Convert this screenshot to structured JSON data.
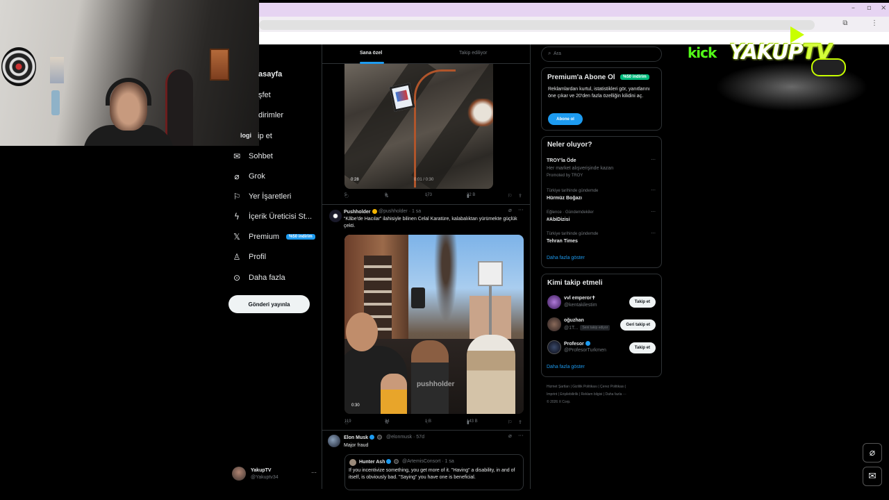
{
  "colors": {
    "accent": "#1d9bf0",
    "background": "#000000",
    "border": "#2f3336",
    "muted": "#71767b",
    "kick_green": "#53fc18"
  },
  "overlay": {
    "kick_label": "kick",
    "brand_main": "YAKUP",
    "brand_tv": "TV"
  },
  "nav": {
    "partial_items": [
      {
        "label": "asayfa"
      },
      {
        "label": "şfet"
      },
      {
        "label": "dirimler"
      },
      {
        "label": "ip et"
      }
    ],
    "overlap_text": "logi",
    "items": [
      {
        "label": "Sohbet",
        "icon": "mail-icon"
      },
      {
        "label": "Grok",
        "icon": "grok-icon"
      },
      {
        "label": "Yer İşaretleri",
        "icon": "bookmark-icon"
      },
      {
        "label": "İçerik Üreticisi St...",
        "icon": "lightning-icon"
      },
      {
        "label": "Premium",
        "icon": "x-logo-icon",
        "badge": "%50 indirim"
      },
      {
        "label": "Profil",
        "icon": "person-icon"
      },
      {
        "label": "Daha fazla",
        "icon": "more-circle-icon"
      }
    ],
    "post_button": "Gönderi yayınla",
    "account": {
      "name": "YakupTV",
      "handle": "@Yakuptv34",
      "more": "···"
    }
  },
  "feed": {
    "tabs": [
      {
        "label": "Sana özel"
      },
      {
        "label": "Takip ediliyor"
      }
    ],
    "post1": {
      "video_elapsed": "0:28",
      "video_progress": "0:01 / 0:30",
      "actions": {
        "replies": "5",
        "reposts": "8",
        "likes": "173",
        "views": "22 B"
      }
    },
    "post2": {
      "name": "Pushholder",
      "handle": "@pushholder · 1 sa",
      "text": "“Kâbe'de Hacılar” ilahisiyle bilinen Celal Karatüre, kalabalıktan yürümekte güçlük çekti.",
      "watermark": "pushholder",
      "video_time": "0:30",
      "actions": {
        "replies": "119",
        "reposts": "34",
        "likes": "1 B",
        "views": "143 B"
      }
    },
    "post3": {
      "name": "Elon Musk",
      "handle": "@elonmusk · 57d",
      "text": "Major fraud",
      "quote": {
        "name": "Hunter Ash",
        "handle": "@ArtemisConsort · 1 sa",
        "text": "If you incentivize something, you get more of it. \"Having\" a disability, in and of itself, is obviously bad. \"Saying\" you have one is beneficial."
      }
    }
  },
  "sidebar": {
    "search_placeholder": "Ara",
    "premium": {
      "title": "Premium'a Abone Ol",
      "badge": "%50 indirim",
      "text": "Reklamlardan kurtul, istatistikleri gör, yanıtlarını öne çıkar ve 20'den fazla özelliğin kilidini aç.",
      "button": "Abone ol"
    },
    "trends": {
      "title": "Neler oluyor?",
      "items": [
        {
          "meta": "",
          "name": "TROY'la Öde",
          "sub": "Her market alışverişinde kazan",
          "promo": "Promoted by TROY"
        },
        {
          "meta": "Türkiye tarihinde gündemde",
          "name": "Hürmüz Boğazı"
        },
        {
          "meta": "Eğlence · Gündemdekiler",
          "name": "#AbiDizisi"
        },
        {
          "meta": "Türkiye tarihinde gündemde",
          "name": "Tehran Times"
        }
      ],
      "show_more": "Daha fazla göster"
    },
    "who_to_follow": {
      "title": "Kimi takip etmeli",
      "items": [
        {
          "name": "vvl emperor✝",
          "handle": "@kentakilestim",
          "button": "Takip et"
        },
        {
          "name": "oğuzhan",
          "handle": "@1T...",
          "follows_you": "Seni takip ediyor",
          "button": "Geri takip et"
        },
        {
          "name": "Profesor",
          "handle": "@ProfesorTurkmen",
          "button": "Takip et"
        }
      ],
      "show_more": "Daha fazla göster"
    },
    "footer": {
      "line1": "Hizmet Şartları  |  Gizlilik Politikası  |  Çerez Politikası  |",
      "line2": "Imprint  |  Erişilebilirlik  |  Reklam bilgisi  |  Daha fazla ···",
      "line3": "© 2026 X Corp."
    }
  }
}
